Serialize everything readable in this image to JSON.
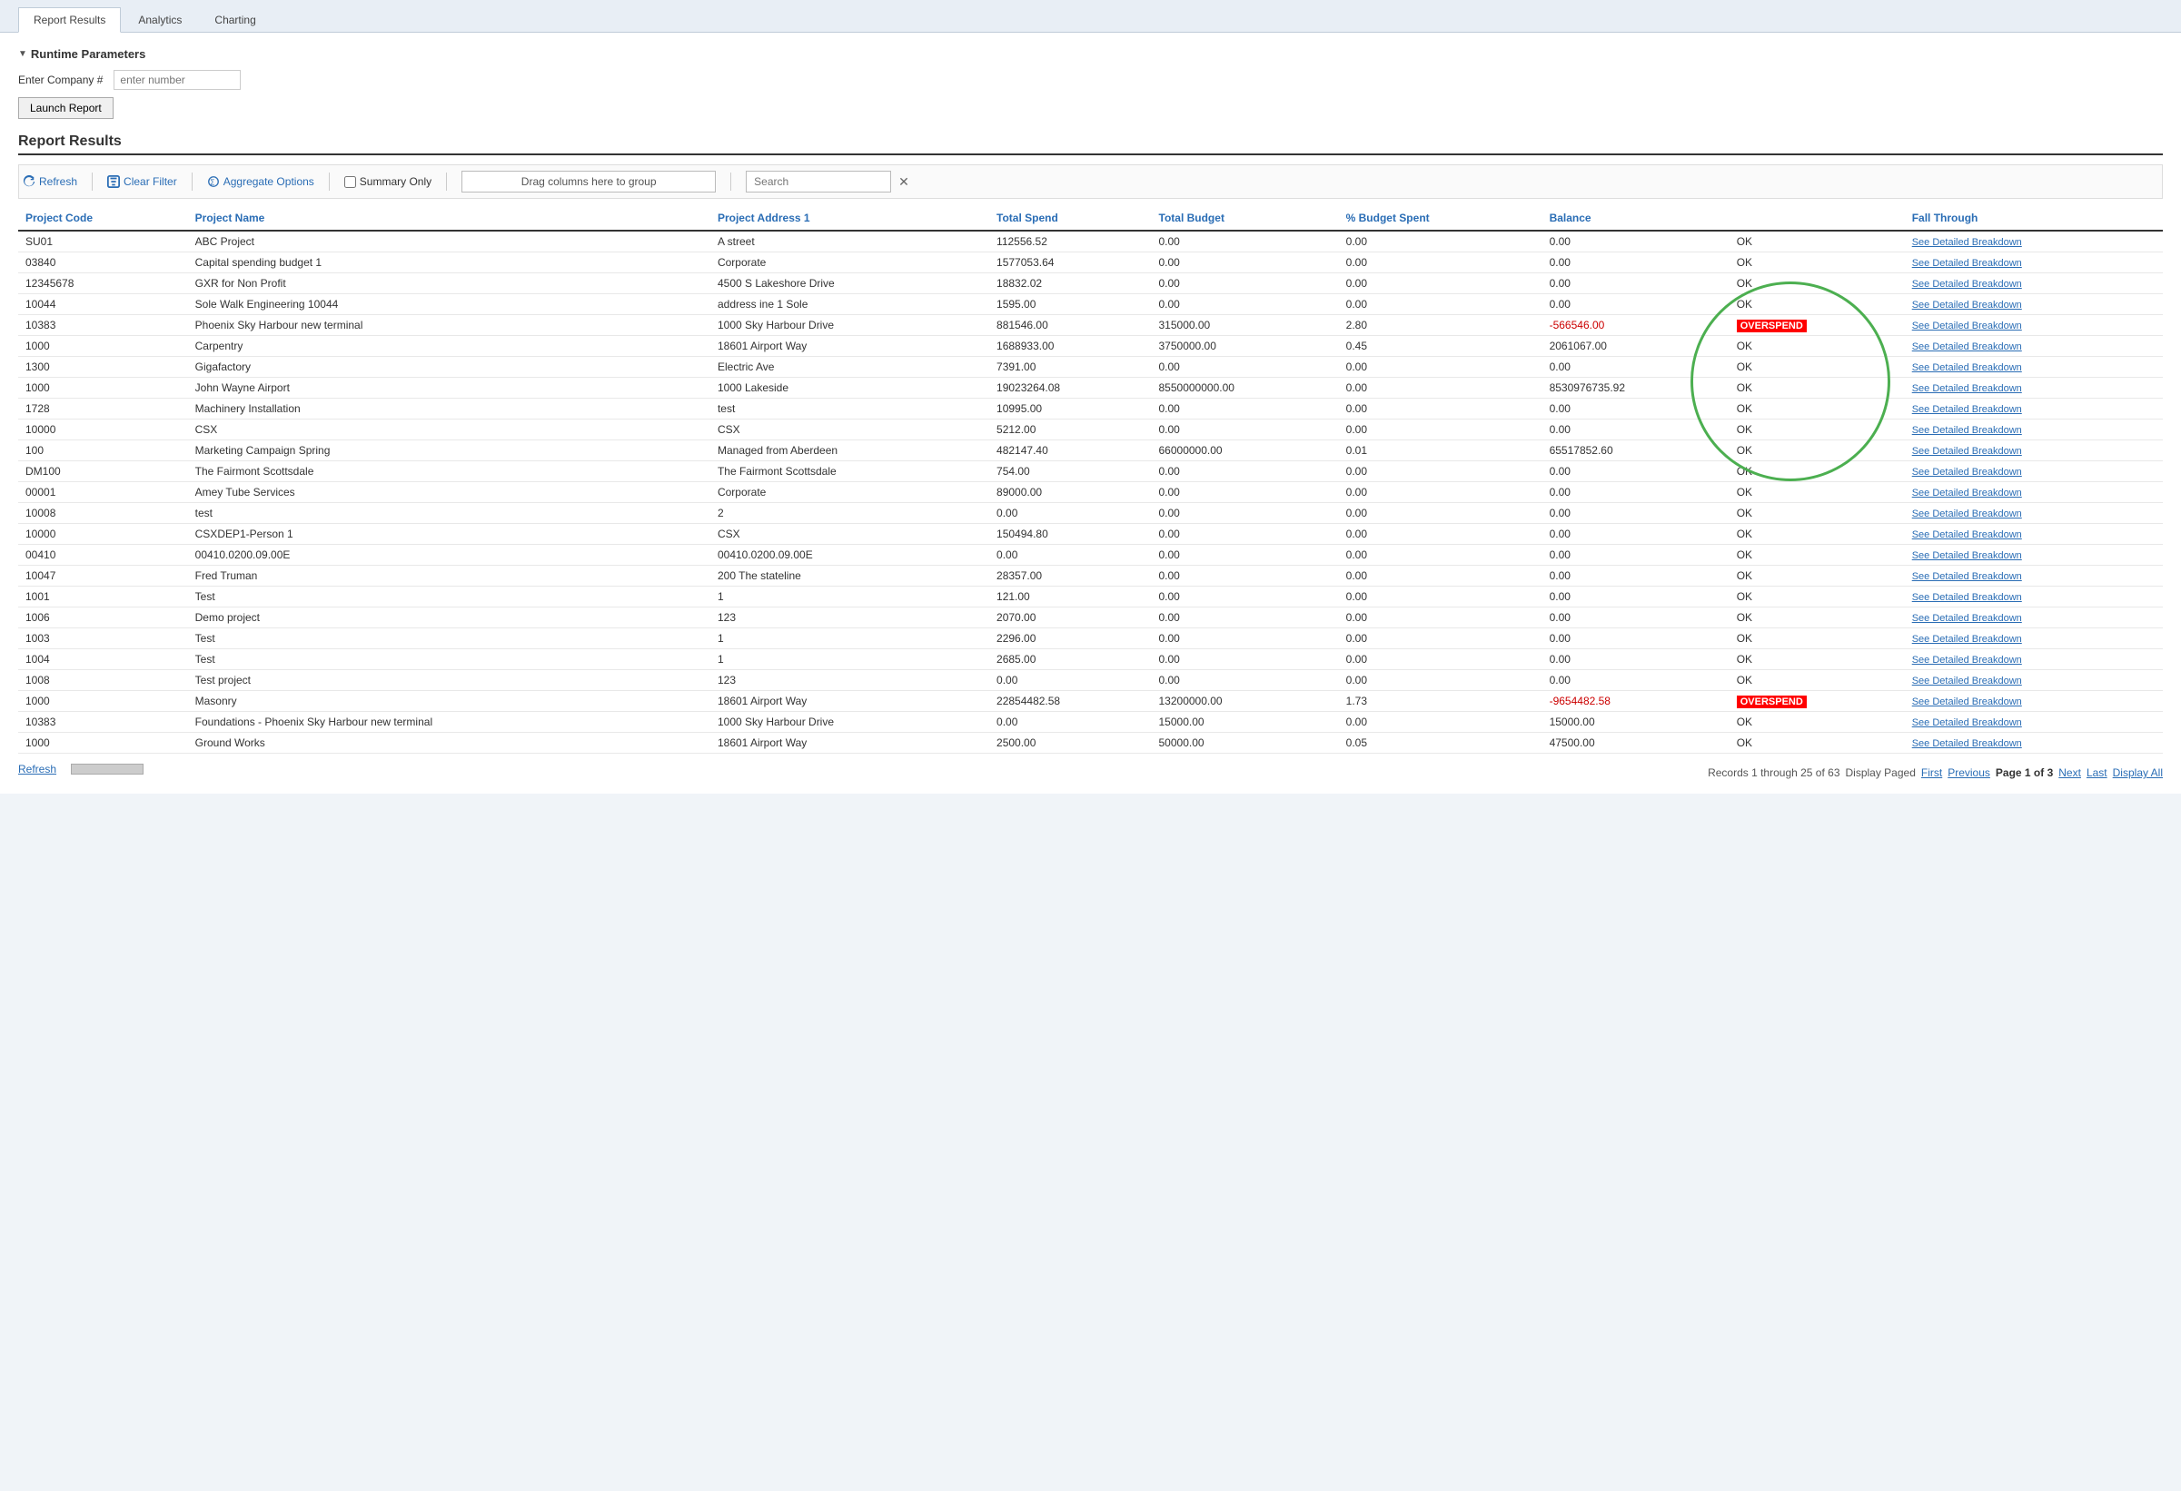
{
  "tabs": [
    {
      "label": "Report Results",
      "active": true
    },
    {
      "label": "Analytics",
      "active": false
    },
    {
      "label": "Charting",
      "active": false
    }
  ],
  "runtime_params": {
    "title": "Runtime Parameters",
    "enter_company_label": "Enter Company #",
    "enter_company_placeholder": "enter number",
    "launch_btn": "Launch Report"
  },
  "report_title": "Report Results",
  "toolbar": {
    "refresh": "Refresh",
    "clear_filter": "Clear Filter",
    "aggregate_options": "Aggregate Options",
    "summary_only": "Summary Only",
    "drag_zone": "Drag columns here to group",
    "search_placeholder": "Search"
  },
  "columns": [
    "Project Code",
    "Project Name",
    "Project Address 1",
    "Total Spend",
    "Total Budget",
    "% Budget Spent",
    "Balance",
    "",
    "Fall Through"
  ],
  "rows": [
    {
      "code": "SU01",
      "name": "ABC Project",
      "address": "A street",
      "total_spend": "112556.52",
      "total_budget": "0.00",
      "pct_budget": "0.00",
      "balance": "0.00",
      "status": "OK",
      "link": "See Detailed Breakdown"
    },
    {
      "code": "03840",
      "name": "Capital spending budget 1",
      "address": "Corporate",
      "total_spend": "1577053.64",
      "total_budget": "0.00",
      "pct_budget": "0.00",
      "balance": "0.00",
      "status": "OK",
      "link": "See Detailed Breakdown"
    },
    {
      "code": "12345678",
      "name": "GXR for Non Profit",
      "address": "4500 S Lakeshore Drive",
      "total_spend": "18832.02",
      "total_budget": "0.00",
      "pct_budget": "0.00",
      "balance": "0.00",
      "status": "OK",
      "link": "See Detailed Breakdown"
    },
    {
      "code": "10044",
      "name": "Sole Walk Engineering 10044",
      "address": "address ine 1 Sole",
      "total_spend": "1595.00",
      "total_budget": "0.00",
      "pct_budget": "0.00",
      "balance": "0.00",
      "status": "OK",
      "link": "See Detailed Breakdown"
    },
    {
      "code": "10383",
      "name": "Phoenix Sky Harbour new terminal",
      "address": "1000 Sky Harbour Drive",
      "total_spend": "881546.00",
      "total_budget": "315000.00",
      "pct_budget": "2.80",
      "balance": "-566546.00",
      "status": "OVERSPEND",
      "link": "See Detailed Breakdown"
    },
    {
      "code": "1000",
      "name": "Carpentry",
      "address": "18601 Airport Way",
      "total_spend": "1688933.00",
      "total_budget": "3750000.00",
      "pct_budget": "0.45",
      "balance": "2061067.00",
      "status": "OK",
      "link": "See Detailed Breakdown"
    },
    {
      "code": "1300",
      "name": "Gigafactory",
      "address": "Electric Ave",
      "total_spend": "7391.00",
      "total_budget": "0.00",
      "pct_budget": "0.00",
      "balance": "0.00",
      "status": "OK",
      "link": "See Detailed Breakdown"
    },
    {
      "code": "1000",
      "name": "John Wayne Airport",
      "address": "1000 Lakeside",
      "total_spend": "19023264.08",
      "total_budget": "8550000000.00",
      "pct_budget": "0.00",
      "balance": "8530976735.92",
      "status": "OK",
      "link": "See Detailed Breakdown"
    },
    {
      "code": "1728",
      "name": "Machinery Installation",
      "address": "test",
      "total_spend": "10995.00",
      "total_budget": "0.00",
      "pct_budget": "0.00",
      "balance": "0.00",
      "status": "OK",
      "link": "See Detailed Breakdown"
    },
    {
      "code": "10000",
      "name": "CSX",
      "address": "CSX",
      "total_spend": "5212.00",
      "total_budget": "0.00",
      "pct_budget": "0.00",
      "balance": "0.00",
      "status": "OK",
      "link": "See Detailed Breakdown"
    },
    {
      "code": "100",
      "name": "Marketing Campaign Spring",
      "address": "Managed from Aberdeen",
      "total_spend": "482147.40",
      "total_budget": "66000000.00",
      "pct_budget": "0.01",
      "balance": "65517852.60",
      "status": "OK",
      "link": "See Detailed Breakdown"
    },
    {
      "code": "DM100",
      "name": "The Fairmont Scottsdale",
      "address": "The Fairmont Scottsdale",
      "total_spend": "754.00",
      "total_budget": "0.00",
      "pct_budget": "0.00",
      "balance": "0.00",
      "status": "OK",
      "link": "See Detailed Breakdown"
    },
    {
      "code": "00001",
      "name": "Amey Tube Services",
      "address": "Corporate",
      "total_spend": "89000.00",
      "total_budget": "0.00",
      "pct_budget": "0.00",
      "balance": "0.00",
      "status": "OK",
      "link": "See Detailed Breakdown"
    },
    {
      "code": "10008",
      "name": "test",
      "address": "2",
      "total_spend": "0.00",
      "total_budget": "0.00",
      "pct_budget": "0.00",
      "balance": "0.00",
      "status": "OK",
      "link": "See Detailed Breakdown"
    },
    {
      "code": "10000",
      "name": "CSXDEP1-Person 1",
      "address": "CSX",
      "total_spend": "150494.80",
      "total_budget": "0.00",
      "pct_budget": "0.00",
      "balance": "0.00",
      "status": "OK",
      "link": "See Detailed Breakdown"
    },
    {
      "code": "00410",
      "name": "00410.0200.09.00E",
      "address": "00410.0200.09.00E",
      "total_spend": "0.00",
      "total_budget": "0.00",
      "pct_budget": "0.00",
      "balance": "0.00",
      "status": "OK",
      "link": "See Detailed Breakdown"
    },
    {
      "code": "10047",
      "name": "Fred Truman",
      "address": "200 The stateline",
      "total_spend": "28357.00",
      "total_budget": "0.00",
      "pct_budget": "0.00",
      "balance": "0.00",
      "status": "OK",
      "link": "See Detailed Breakdown"
    },
    {
      "code": "1001",
      "name": "Test",
      "address": "1",
      "total_spend": "121.00",
      "total_budget": "0.00",
      "pct_budget": "0.00",
      "balance": "0.00",
      "status": "OK",
      "link": "See Detailed Breakdown"
    },
    {
      "code": "1006",
      "name": "Demo project",
      "address": "123",
      "total_spend": "2070.00",
      "total_budget": "0.00",
      "pct_budget": "0.00",
      "balance": "0.00",
      "status": "OK",
      "link": "See Detailed Breakdown"
    },
    {
      "code": "1003",
      "name": "Test",
      "address": "1",
      "total_spend": "2296.00",
      "total_budget": "0.00",
      "pct_budget": "0.00",
      "balance": "0.00",
      "status": "OK",
      "link": "See Detailed Breakdown"
    },
    {
      "code": "1004",
      "name": "Test",
      "address": "1",
      "total_spend": "2685.00",
      "total_budget": "0.00",
      "pct_budget": "0.00",
      "balance": "0.00",
      "status": "OK",
      "link": "See Detailed Breakdown"
    },
    {
      "code": "1008",
      "name": "Test project",
      "address": "123",
      "total_spend": "0.00",
      "total_budget": "0.00",
      "pct_budget": "0.00",
      "balance": "0.00",
      "status": "OK",
      "link": "See Detailed Breakdown"
    },
    {
      "code": "1000",
      "name": "Masonry",
      "address": "18601 Airport Way",
      "total_spend": "22854482.58",
      "total_budget": "13200000.00",
      "pct_budget": "1.73",
      "balance": "-9654482.58",
      "status": "OVERSPEND",
      "link": "See Detailed Breakdown"
    },
    {
      "code": "10383",
      "name": "Foundations - Phoenix Sky Harbour new terminal",
      "address": "1000 Sky Harbour Drive",
      "total_spend": "0.00",
      "total_budget": "15000.00",
      "pct_budget": "0.00",
      "balance": "15000.00",
      "status": "OK",
      "link": "See Detailed Breakdown"
    },
    {
      "code": "1000",
      "name": "Ground Works",
      "address": "18601 Airport Way",
      "total_spend": "2500.00",
      "total_budget": "50000.00",
      "pct_budget": "0.05",
      "balance": "47500.00",
      "status": "OK",
      "link": "See Detailed Breakdown"
    }
  ],
  "pagination": {
    "info": "Records 1 through 25 of 63",
    "display_paged": "Display Paged",
    "first": "First",
    "previous": "Previous",
    "page_label": "Page 1 of 3",
    "next": "Next",
    "last": "Last",
    "display_all": "Display All"
  },
  "bottom": {
    "refresh": "Refresh"
  }
}
